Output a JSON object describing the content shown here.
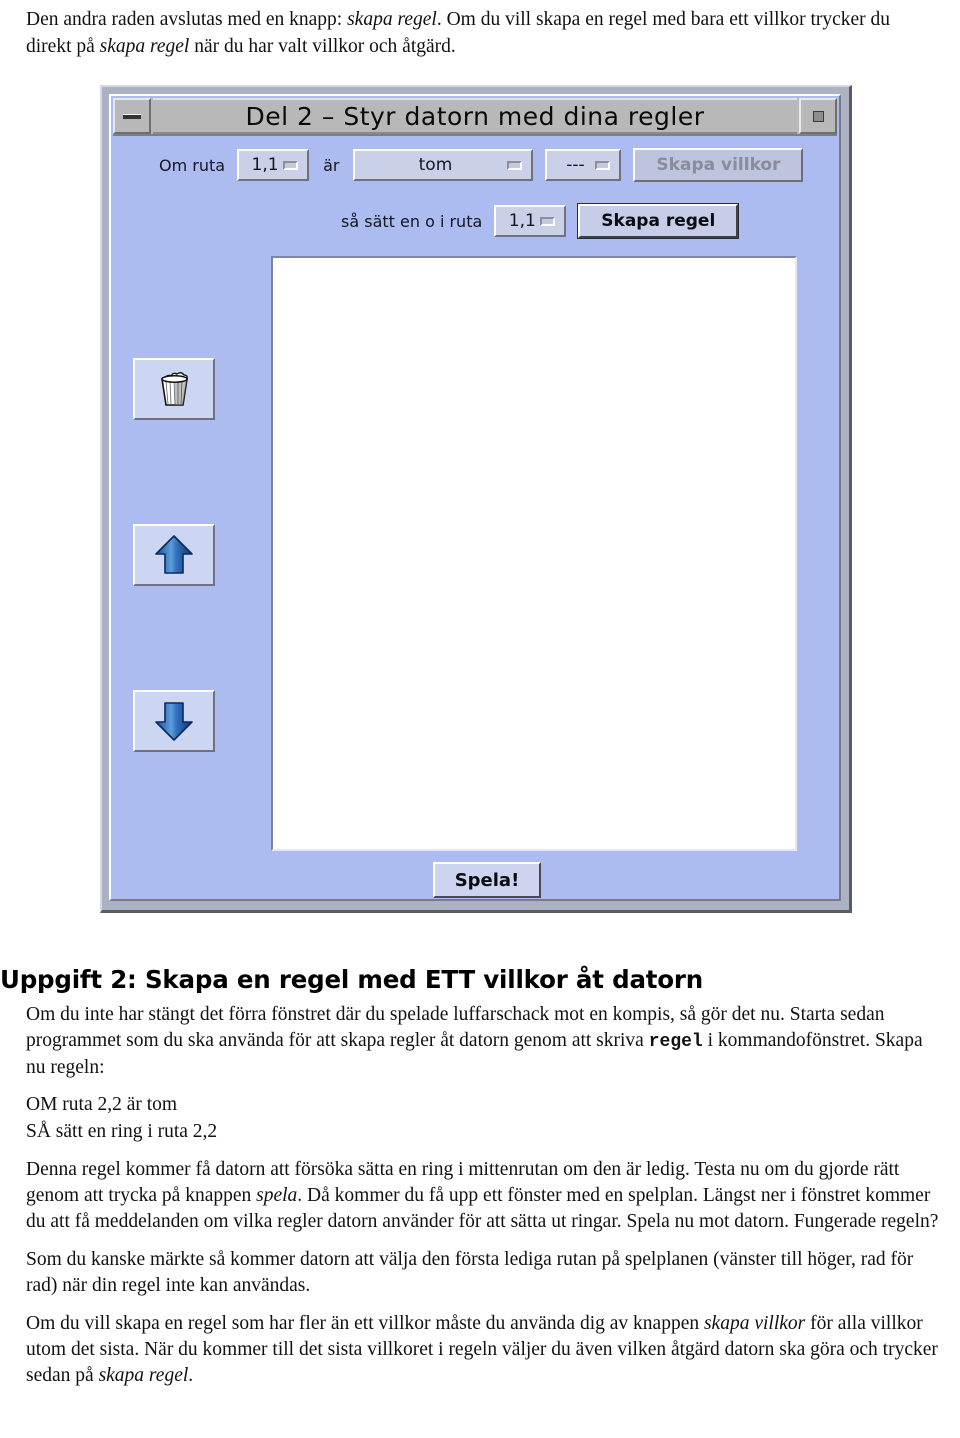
{
  "intro": {
    "segments": [
      {
        "text": "Den andra raden avslutas med en knapp: ",
        "style": "normal"
      },
      {
        "text": "skapa regel",
        "style": "italic"
      },
      {
        "text": ". Om du vill skapa en regel med bara ett villkor trycker du direkt på ",
        "style": "normal"
      },
      {
        "text": "skapa regel",
        "style": "italic"
      },
      {
        "text": " när du har valt villkor och åtgärd.",
        "style": "normal"
      }
    ],
    "line1_a": "Den andra raden avslutas med en knapp: ",
    "line1_it": "skapa regel",
    "line1_b": ". Om du vill skapa en regel med bara ett villkor trycker du direkt på ",
    "line1_it2": "skapa regel",
    "line1_c": " när du har valt villkor och åtgärd."
  },
  "app_window": {
    "title": "Del 2 – Styr datorn med dina regler",
    "titlebar": {
      "minimize_icon": "minimize-icon",
      "maximize_icon": "maximize-icon"
    },
    "condition_row": {
      "prefix_label": "Om ruta",
      "cell_value": "1,1",
      "verb_label": "är",
      "state_value": "tom",
      "connector_value": "---",
      "create_condition_label": "Skapa villkor",
      "create_condition_enabled": false
    },
    "action_row": {
      "prefix_label": "så sätt en o i ruta",
      "cell_value": "1,1",
      "create_rule_label": "Skapa regel"
    },
    "side_buttons": [
      {
        "name": "delete-rule-button",
        "icon": "trash-can-icon"
      },
      {
        "name": "move-up-button",
        "icon": "arrow-up-icon"
      },
      {
        "name": "move-down-button",
        "icon": "arrow-down-icon"
      }
    ],
    "rules_list": {
      "items": [],
      "placeholder": ""
    },
    "play_button_label": "Spela!",
    "colors": {
      "window_background": "#adbcf0",
      "titlebar": "#b8b8b8",
      "widget_face": "#c9d0e8",
      "list_background": "#ffffff",
      "arrow_icon": "#1f5fb0"
    }
  },
  "task": {
    "heading": "Uppgift 2: Skapa en regel med ETT villkor åt datorn",
    "p1_a": "Om du inte har stängt det förra fönstret där du spelade luffarschack mot en kompis, så gör det nu. Starta sedan programmet som du ska använda för att skapa regler åt datorn genom att skriva ",
    "p1_mono": "regel",
    "p1_b": " i kommandofönstret. Skapa nu regeln:",
    "rule_line_1": "OM ruta 2,2 är tom",
    "rule_line_2": "SÅ sätt en ring i ruta 2,2",
    "p2_a": "Denna regel kommer få datorn att försöka sätta en ring i mittenrutan om den är ledig. Testa nu om du gjorde rätt genom att trycka på knappen ",
    "p2_it": "spela",
    "p2_b": ". Då kommer du få upp ett fönster med en spelplan. Längst ner i fönstret kommer du att få meddelanden om vilka regler datorn använder för att sätta ut ringar. Spela nu mot datorn. Fungerade regeln?",
    "p3": "Som du kanske märkte så kommer datorn att välja den första lediga rutan på spelplanen (vänster till höger, rad för rad) när din regel inte kan användas.",
    "p4_a": "Om du vill skapa en regel som har fler än ett villkor måste du använda dig av knappen ",
    "p4_it1": "skapa villkor",
    "p4_b": " för alla villkor utom det sista. När du kommer till det sista villkoret i regeln väljer du även vilken åtgärd datorn ska göra och trycker sedan på ",
    "p4_it2": "skapa regel",
    "p4_c": "."
  }
}
